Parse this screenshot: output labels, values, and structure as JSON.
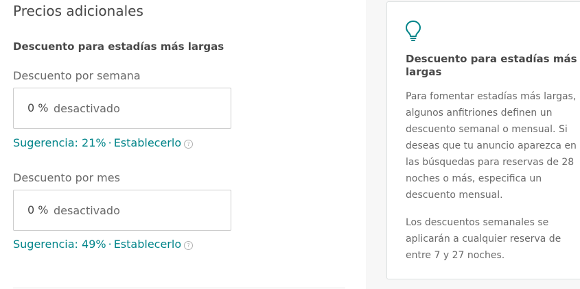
{
  "section": {
    "title": "Precios adicionales",
    "subheading": "Descuento para estadías más largas"
  },
  "weekly": {
    "label": "Descuento por semana",
    "value": "0 %",
    "placeholder": "desactivado",
    "suggestion": "Sugerencia: 21%",
    "separator": "·",
    "set_label": "Establecerlo",
    "help_glyph": "?"
  },
  "monthly": {
    "label": "Descuento por mes",
    "value": "0 %",
    "placeholder": "desactivado",
    "suggestion": "Sugerencia: 49%",
    "separator": "·",
    "set_label": "Establecerlo",
    "help_glyph": "?"
  },
  "tip": {
    "icon": "lightbulb-icon",
    "title": "Descuento para estadías más largas",
    "paragraph1": "Para fomentar estadías más largas, algunos anfitriones definen un descuento semanal o mensual. Si deseas que tu anuncio aparezca en las búsquedas para reservas de 28 noches o más, especifica un descuento mensual.",
    "paragraph2": "Los descuentos semanales se aplicarán a cualquier reserva de entre 7 y 27 noches."
  },
  "colors": {
    "accent": "#008489",
    "text": "#484848",
    "muted": "#6a6a6a",
    "border": "#cccccc",
    "panel_bg": "#f7f7f7"
  }
}
